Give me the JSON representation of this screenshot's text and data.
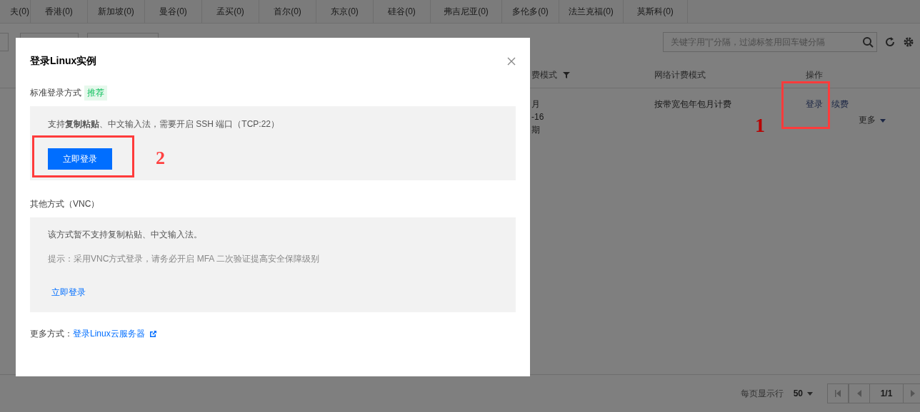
{
  "region_tabs": [
    {
      "label": "夫(0)"
    },
    {
      "label": "香港(0)"
    },
    {
      "label": "新加坡(0)"
    },
    {
      "label": "曼谷(0)"
    },
    {
      "label": "孟买(0)"
    },
    {
      "label": "首尔(0)"
    },
    {
      "label": "东京(0)"
    },
    {
      "label": "硅谷(0)"
    },
    {
      "label": "弗吉尼亚(0)"
    },
    {
      "label": "多伦多(0)"
    },
    {
      "label": "法兰克福(0)"
    },
    {
      "label": "莫斯科(0)"
    }
  ],
  "toolbar": {
    "search": {
      "placeholder": "关键字用\"|\"分隔，过滤标签用回车键分隔"
    }
  },
  "table": {
    "columns": [
      {
        "label": "费模式",
        "filter": true
      },
      {
        "label": "网络计费模式",
        "filter": false
      },
      {
        "label": "操作",
        "filter": false
      }
    ],
    "rows": [
      {
        "column_1": [
          "月",
          "-16",
          "期"
        ],
        "network_billing": "按带宽包年包月计费",
        "actions": [
          {
            "label": "登录",
            "kind": "link"
          },
          {
            "label": "续费",
            "kind": "link"
          },
          {
            "label": "更多",
            "kind": "dropdown"
          }
        ]
      }
    ]
  },
  "pagination": {
    "rows_label": "每页显示行",
    "page_size": "50",
    "page": "1/1"
  },
  "annotations": [
    {
      "label": "1"
    },
    {
      "label": "2"
    }
  ],
  "modal": {
    "title": "登录Linux实例",
    "standard": {
      "label": "标准登录方式",
      "tag": "推荐",
      "description": "支持**复制粘贴**、中文输入法，需要开启 SSH 端口（TCP:22）",
      "button": "立即登录"
    },
    "other": {
      "label": "其他方式（VNC）",
      "description": "该方式暂不支持复制粘贴、中文输入法。",
      "hint": "提示：采用VNC方式登录，请务必开启 MFA 二次验证提高安全保障级别",
      "link": "立即登录"
    },
    "more": {
      "label": "更多方式：",
      "link": "登录Linux云服务器"
    }
  }
}
